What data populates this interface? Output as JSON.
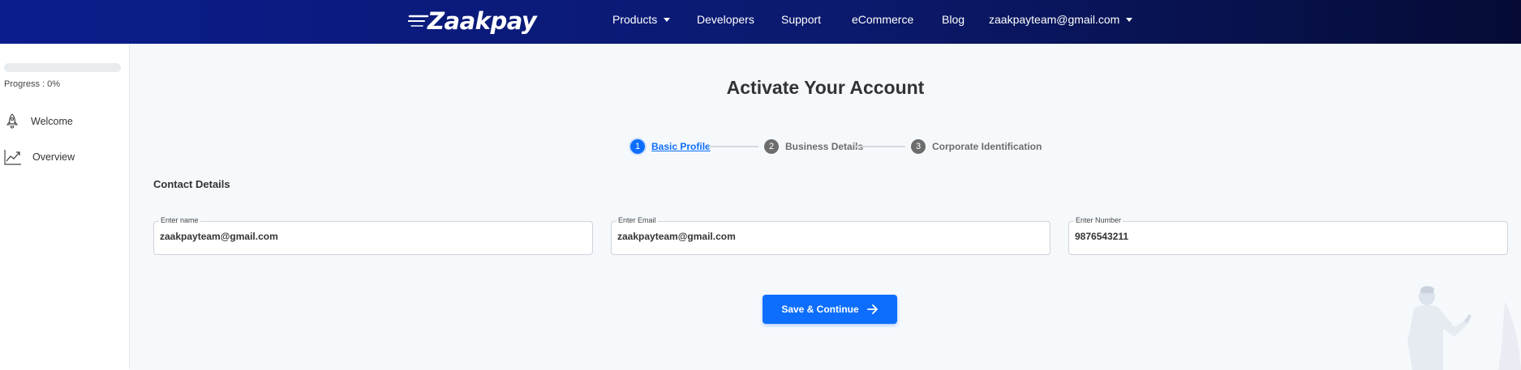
{
  "header": {
    "brand": "Zaakpay",
    "nav": [
      {
        "label": "Products",
        "dropdown": true
      },
      {
        "label": "Developers"
      },
      {
        "label": "Support"
      },
      {
        "label": "eCommerce"
      },
      {
        "label": "Blog"
      }
    ],
    "account": "zaakpayteam@gmail.com"
  },
  "sidebar": {
    "progress_value": 0,
    "progress_label": "Progress : 0%",
    "items": [
      {
        "label": "Welcome",
        "icon": "rocket-icon"
      },
      {
        "label": "Overview",
        "icon": "trend-chart-icon"
      }
    ]
  },
  "main": {
    "title": "Activate Your Account",
    "steps": [
      {
        "num": "1",
        "label": "Basic Profile",
        "active": true
      },
      {
        "num": "2",
        "label": "Business Details",
        "active": false
      },
      {
        "num": "3",
        "label": "Corporate Identification",
        "active": false
      }
    ],
    "section_title": "Contact Details",
    "fields": [
      {
        "label": "Enter name",
        "value": "zaakpayteam@gmail.com"
      },
      {
        "label": "Enter Email",
        "value": "zaakpayteam@gmail.com"
      },
      {
        "label": "Enter Number",
        "value": "9876543211"
      }
    ],
    "save_button": "Save & Continue"
  },
  "colors": {
    "header_gradient_start": "#0a1c8c",
    "header_gradient_end": "#050b35",
    "accent": "#0d6efd",
    "inactive_step": "#6c6c6c",
    "main_background": "#f6f9fc"
  }
}
